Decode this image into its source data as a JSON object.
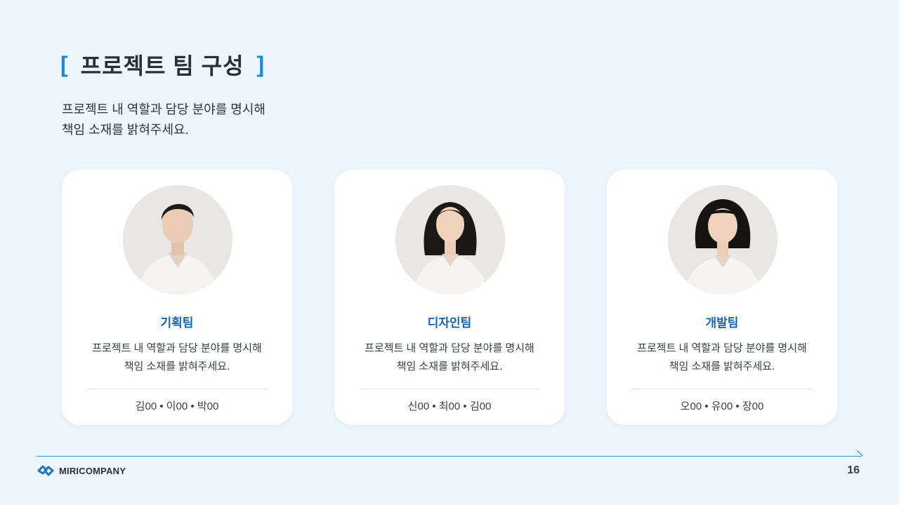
{
  "header": {
    "bracket_open": "[",
    "title": "프로젝트 팀 구성",
    "bracket_close": "]",
    "subtitle_line1": "프로젝트 내 역할과 담당 분야를 명시해",
    "subtitle_line2": "책임 소재를 밝혀주세요."
  },
  "cards": [
    {
      "team": "기획팀",
      "desc_line1": "프로젝트 내 역할과 담당 분야를 명시해",
      "desc_line2": "책임 소재를 밝혀주세요.",
      "members": "김00 • 이00 • 박00"
    },
    {
      "team": "디자인팀",
      "desc_line1": "프로젝트 내 역할과 담당 분야를 명시해",
      "desc_line2": "책임 소재를 밝혀주세요.",
      "members": "신00 • 최00 • 김00"
    },
    {
      "team": "개발팀",
      "desc_line1": "프로젝트 내 역할과 담당 분야를 명시해",
      "desc_line2": "책임 소재를 밝혀주세요.",
      "members": "오00 • 유00 • 장00"
    }
  ],
  "footer": {
    "company": "MIRICOMPANY",
    "page_number": "16"
  },
  "colors": {
    "background": "#edf5fd",
    "accent": "#1e88d8",
    "team_label": "#1565b5"
  }
}
